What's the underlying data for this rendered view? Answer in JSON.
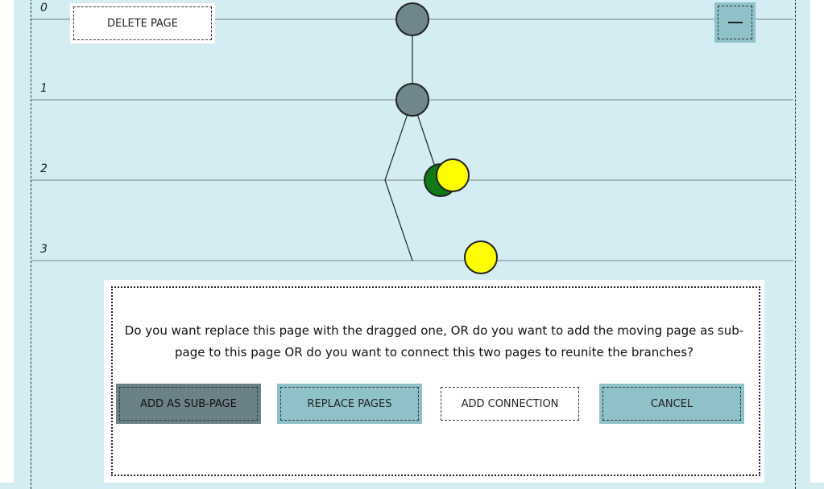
{
  "levels": [
    "0",
    "1",
    "2",
    "3"
  ],
  "toolbar": {
    "delete_page_label": "DELETE PAGE",
    "collapse_label": "—"
  },
  "dialog": {
    "message": "Do you want replace this page with the dragged one, OR do you want to add the moving page as sub-page to this page OR do you want to connect this two pages to reunite the branches?",
    "buttons": {
      "add_sub_page": "ADD AS SUB-PAGE",
      "replace_pages": "REPLACE PAGES",
      "add_connection": "ADD CONNECTION",
      "cancel": "CANCEL"
    }
  },
  "colors": {
    "background": "#d4edf2",
    "node_gray": "#6f868a",
    "node_green": "#0f7a16",
    "node_yellow": "#ffff00",
    "button_teal": "#8fc1c8",
    "button_dark": "#6a8187"
  }
}
